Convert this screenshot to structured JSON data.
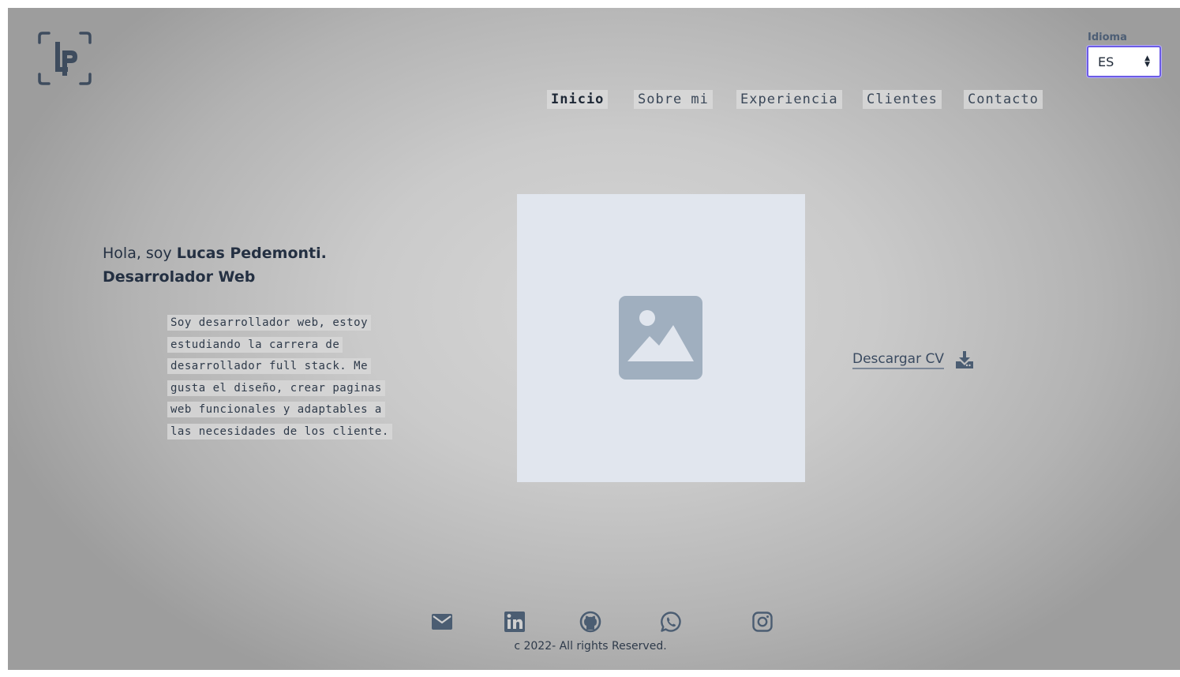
{
  "header": {
    "logo_text": "LP",
    "language": {
      "label": "Idioma",
      "selected": "ES"
    },
    "nav": [
      {
        "label": "Inicio",
        "active": true
      },
      {
        "label": "Sobre mi",
        "active": false
      },
      {
        "label": "Experiencia",
        "active": false
      },
      {
        "label": "Clientes",
        "active": false
      },
      {
        "label": "Contacto",
        "active": false
      }
    ]
  },
  "hero": {
    "greeting": "Hola, soy ",
    "name": "Lucas Pedemonti.",
    "role": "Desarrolador Web",
    "bio": "Soy desarrollador web, estoy estudiando la carrera de desarrollador full stack. Me gusta el diseño, crear paginas web funcionales y adaptables a las necesidades de los cliente.",
    "photo_icon": "image-placeholder-icon",
    "cv_label": "Descargar CV",
    "cv_icon": "download-icon"
  },
  "footer": {
    "social": [
      {
        "icon": "email-icon"
      },
      {
        "icon": "linkedin-icon"
      },
      {
        "icon": "github-icon"
      },
      {
        "icon": "whatsapp-icon"
      },
      {
        "icon": "instagram-icon"
      }
    ],
    "copyright": "c 2022- All rights Reserved."
  },
  "colors": {
    "text": "#2a3544",
    "accent_focus": "#6c5ce7",
    "icon": "#4b5d72",
    "placeholder_bg": "#e1e6ee",
    "placeholder_icon": "#a0afbf"
  }
}
